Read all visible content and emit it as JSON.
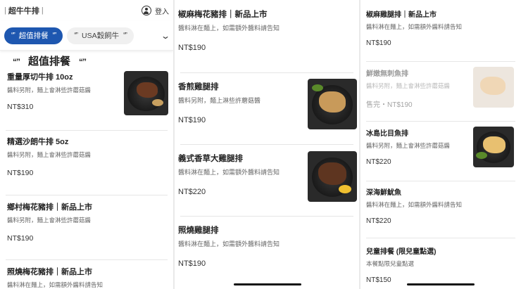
{
  "header": {
    "brand_prefix": "|",
    "brand": "超牛牛排",
    "brand_suffix": "|",
    "login": "登入"
  },
  "tabs": [
    {
      "quote_open": "“”",
      "label": "超值排餐",
      "quote_close": "“”",
      "active": true
    },
    {
      "quote_open": "“”",
      "label": "USA穀飼牛",
      "quote_close": "“”",
      "active": false
    }
  ],
  "section": {
    "quote_open": "“”",
    "title": "超值排餐",
    "quote_close": "“”"
  },
  "panel1": [
    {
      "name": "重量厚切牛排 10oz",
      "desc": "醬料另附，麵上會淋些許蘑菇醬",
      "price": "NT$310",
      "image": "steak-plate"
    },
    {
      "name": "精選沙朗牛排 5oz",
      "desc": "醬料另附，麵上會淋些許蘑菇醬",
      "price": "NT$190"
    },
    {
      "name": "鄉村梅花豬排｜新品上市",
      "desc": "醬料另附，麵上會淋些許蘑菇醬",
      "price": "NT$190"
    },
    {
      "name": "照燒梅花豬排｜新品上市",
      "desc": "醬料淋在麵上，如需額外醬料請告知"
    }
  ],
  "panel2": [
    {
      "name": "椒麻梅花豬排｜新品上市",
      "desc": "醬料淋在麵上，如需額外醬料請告知",
      "price": "NT$190"
    },
    {
      "name": "香煎雞腿排",
      "desc": "醬料另附，麵上淋些許蘑菇醬",
      "price": "NT$190",
      "image": "chicken-plate"
    },
    {
      "name": "義式香草大雞腿排",
      "desc": "醬料淋在麵上，如需額外醬料請告知",
      "price": "NT$220",
      "image": "herb-chicken-plate"
    },
    {
      "name": "照燒雞腿排",
      "desc": "醬料淋在麵上，如需額外醬料請告知",
      "price": "NT$190"
    }
  ],
  "panel3": [
    {
      "name": "椒麻雞腿排｜新品上市",
      "desc": "醬料淋在麵上，如需額外醬料請告知",
      "price": "NT$190"
    },
    {
      "name": "鮮嫩無刺魚排",
      "desc": "醬料另附，麵上會淋些許蘑菇醬",
      "price": "售完・NT$190",
      "image": "fish-plate",
      "sold_out": true
    },
    {
      "name": "冰島比目魚排",
      "desc": "醬料另附，麵上會淋些許蘑菇醬",
      "price": "NT$220",
      "image": "halibut-plate"
    },
    {
      "name": "深海鮮魷魚",
      "desc": "醬料淋在麵上，如需額外醬料請告知",
      "price": "NT$220"
    },
    {
      "name": "兒童排餐 (限兒童點選)",
      "desc": "本餐點限兒童點選",
      "price": "NT$150"
    }
  ],
  "colors": {
    "accent": "#1e57b0",
    "background": "#ffffff",
    "divider": "#e6e6e6"
  }
}
